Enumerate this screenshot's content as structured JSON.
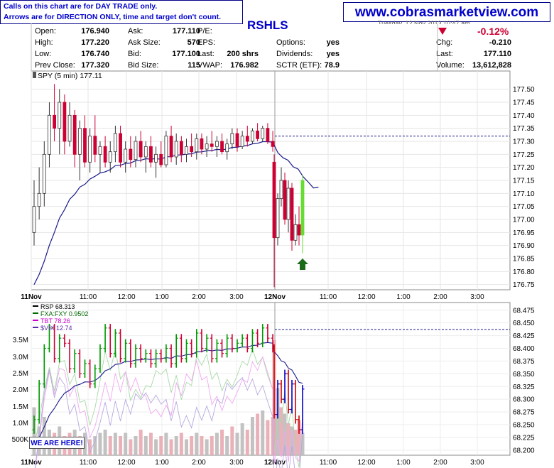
{
  "notice": {
    "line1": "Calls on this chart are for DAY TRADE only.",
    "line2": "Arrows are for DIRECTION ONLY, time and target don't count."
  },
  "brand": "www.cobrasmarketview.com",
  "ticker": "RSHLS",
  "date_header": "Tuesday, 12 Nov 2013 10:47 am",
  "change_percent": "-0.12%",
  "quote": {
    "open_label": "Open:",
    "open": "176.940",
    "high_label": "High:",
    "high": "177.220",
    "low_label": "Low:",
    "low": "176.740",
    "prevclose_label": "Prev Close:",
    "prevclose": "177.320",
    "ask_label": "Ask:",
    "ask": "177.110",
    "asksize_label": "Ask Size:",
    "asksize": "570",
    "bid_label": "Bid:",
    "bid": "177.100",
    "bidsize_label": "Bid Size:",
    "bidsize": "115",
    "pe_label": "P/E:",
    "pe": "",
    "eps_label": "EPS:",
    "eps": "",
    "last_label": "Last:",
    "last_shares": "200 shrs",
    "vwap_label": "VWAP:",
    "vwap": "176.982",
    "options_label": "Options:",
    "options": "yes",
    "dividends_label": "Dividends:",
    "dividends": "yes",
    "sctr_label": "SCTR (ETF):",
    "sctr": "78.9",
    "chg_label": "Chg:",
    "chg": "-0.210",
    "last2_label": "Last:",
    "last2": "177.110",
    "volume_label": "Volume:",
    "volume": "13,612,828"
  },
  "colors": {
    "up": "#009900",
    "down": "#cc0033",
    "ma": "#1a1a8c",
    "brand": "#0000cc",
    "signal": "#1a6a1a",
    "spy_up_candle": "#ffffff",
    "spy_down_candle": "#cc0033",
    "spy_last_candle": "#66dd33"
  },
  "here_label": "WE ARE HERE!",
  "chart_data": [
    {
      "type": "candlestick",
      "title": "SPY (5 min) 177.11",
      "symbol": "SPY",
      "interval": "5 min",
      "last": 177.11,
      "ylim": [
        176.73,
        177.57
      ],
      "yticks": [
        "177.50",
        "177.45",
        "177.40",
        "177.35",
        "177.30",
        "177.25",
        "177.20",
        "177.15",
        "177.10",
        "177.05",
        "177.00",
        "176.95",
        "176.90",
        "176.85",
        "176.80",
        "176.75"
      ],
      "xticks": [
        "11Nov",
        "11:00",
        "12:00",
        "1:00",
        "2:00",
        "3:00",
        "12Nov",
        "11:00",
        "12:00",
        "1:00",
        "2:00",
        "3:00"
      ],
      "reference_line": 177.32,
      "signal": "up arrow",
      "ohlc": [
        [
          176.95,
          177.15,
          176.9,
          177.05
        ],
        [
          177.05,
          177.2,
          177.0,
          177.1
        ],
        [
          177.1,
          177.3,
          177.05,
          177.25
        ],
        [
          177.25,
          177.45,
          177.2,
          177.4
        ],
        [
          177.4,
          177.52,
          177.3,
          177.35
        ],
        [
          177.35,
          177.5,
          177.25,
          177.45
        ],
        [
          177.45,
          177.48,
          177.25,
          177.3
        ],
        [
          177.3,
          177.45,
          177.28,
          177.4
        ],
        [
          177.4,
          177.42,
          177.2,
          177.25
        ],
        [
          177.25,
          177.38,
          177.15,
          177.35
        ],
        [
          177.35,
          177.4,
          177.2,
          177.22
        ],
        [
          177.22,
          177.35,
          177.18,
          177.32
        ],
        [
          177.32,
          177.4,
          177.22,
          177.25
        ],
        [
          177.25,
          177.3,
          177.18,
          177.28
        ],
        [
          177.28,
          177.32,
          177.2,
          177.22
        ],
        [
          177.22,
          177.3,
          177.18,
          177.26
        ],
        [
          177.26,
          177.36,
          177.22,
          177.33
        ],
        [
          177.33,
          177.36,
          177.2,
          177.22
        ],
        [
          177.22,
          177.3,
          177.18,
          177.27
        ],
        [
          177.27,
          177.32,
          177.2,
          177.23
        ],
        [
          177.23,
          177.32,
          177.2,
          177.3
        ],
        [
          177.3,
          177.34,
          177.22,
          177.24
        ],
        [
          177.24,
          177.3,
          177.18,
          177.28
        ],
        [
          177.28,
          177.32,
          177.2,
          177.22
        ],
        [
          177.22,
          177.28,
          177.16,
          177.25
        ],
        [
          177.25,
          177.3,
          177.2,
          177.21
        ],
        [
          177.21,
          177.34,
          177.2,
          177.32
        ],
        [
          177.32,
          177.36,
          177.22,
          177.24
        ],
        [
          177.24,
          177.33,
          177.21,
          177.3
        ],
        [
          177.3,
          177.32,
          177.22,
          177.25
        ],
        [
          177.25,
          177.31,
          177.22,
          177.28
        ],
        [
          177.28,
          177.33,
          177.24,
          177.26
        ],
        [
          177.26,
          177.33,
          177.23,
          177.31
        ],
        [
          177.31,
          177.33,
          177.25,
          177.27
        ],
        [
          177.27,
          177.32,
          177.24,
          177.29
        ],
        [
          177.29,
          177.34,
          177.26,
          177.28
        ],
        [
          177.28,
          177.32,
          177.24,
          177.3
        ],
        [
          177.3,
          177.33,
          177.25,
          177.26
        ],
        [
          177.26,
          177.31,
          177.23,
          177.29
        ],
        [
          177.29,
          177.35,
          177.27,
          177.33
        ],
        [
          177.33,
          177.35,
          177.26,
          177.28
        ],
        [
          177.28,
          177.34,
          177.27,
          177.32
        ],
        [
          177.32,
          177.36,
          177.28,
          177.3
        ],
        [
          177.3,
          177.35,
          177.29,
          177.34
        ],
        [
          177.34,
          177.37,
          177.3,
          177.31
        ],
        [
          177.31,
          177.36,
          177.3,
          177.35
        ],
        [
          177.35,
          177.37,
          177.29,
          177.3
        ],
        [
          177.3,
          177.34,
          177.26,
          177.28
        ],
        [
          177.22,
          177.25,
          176.74,
          176.93
        ],
        [
          176.93,
          177.1,
          176.9,
          177.08
        ],
        [
          177.08,
          177.2,
          177.05,
          177.15
        ],
        [
          177.15,
          177.18,
          176.98,
          177.0
        ],
        [
          177.0,
          177.15,
          176.95,
          177.12
        ],
        [
          177.12,
          177.14,
          176.88,
          176.92
        ],
        [
          176.92,
          177.02,
          176.9,
          176.98
        ],
        [
          176.98,
          177.05,
          176.9,
          176.94
        ],
        [
          176.94,
          177.17,
          176.87,
          177.15
        ]
      ]
    },
    {
      "type": "line",
      "title": "RSP 68.313",
      "series": [
        {
          "name": "RSP",
          "last": 68.313
        },
        {
          "name": "FXA:FXY",
          "last": 0.9502
        },
        {
          "name": "TBT",
          "last": 78.26
        },
        {
          "name": "$VIX",
          "last": 12.74
        }
      ],
      "ylim": [
        68.19,
        68.49
      ],
      "yticks": [
        "68.475",
        "68.450",
        "68.425",
        "68.400",
        "68.375",
        "68.350",
        "68.325",
        "68.300",
        "68.275",
        "68.250",
        "68.225",
        "68.200"
      ],
      "volume_ticks": [
        "3.5M",
        "3.0M",
        "2.5M",
        "2.0M",
        "1.5M",
        "1.0M",
        "500K"
      ],
      "xticks": [
        "11Nov",
        "11:00",
        "12:00",
        "1:00",
        "2:00",
        "3:00",
        "12Nov",
        "11:00",
        "12:00",
        "1:00",
        "2:00",
        "3:00"
      ],
      "reference_line": 68.437,
      "rsp_close": [
        68.26,
        68.33,
        68.4,
        68.44,
        68.38,
        68.42,
        68.41,
        68.36,
        68.39,
        68.35,
        68.37,
        68.33,
        68.36,
        68.4,
        68.44,
        68.39,
        68.43,
        68.38,
        68.41,
        68.37,
        68.4,
        68.38,
        68.39,
        68.37,
        68.39,
        68.38,
        68.4,
        68.37,
        68.42,
        68.38,
        68.41,
        68.39,
        68.43,
        68.4,
        68.42,
        68.38,
        68.41,
        68.39,
        68.42,
        68.4,
        68.41,
        68.42,
        68.4,
        68.43,
        68.41,
        68.44,
        68.42,
        68.4,
        68.27,
        68.33,
        68.3,
        68.35,
        68.28,
        68.33,
        68.26,
        68.24,
        68.32
      ],
      "volume_millions": [
        1.5,
        0.9,
        1.2,
        0.8,
        0.7,
        0.9,
        0.6,
        0.7,
        0.8,
        0.6,
        0.7,
        0.5,
        0.6,
        0.7,
        0.8,
        0.6,
        0.7,
        0.6,
        0.7,
        0.5,
        0.6,
        0.8,
        0.6,
        0.7,
        0.5,
        0.6,
        0.7,
        0.5,
        0.6,
        0.7,
        0.5,
        0.6,
        0.7,
        0.6,
        0.5,
        0.6,
        0.7,
        0.8,
        0.6,
        0.9,
        0.7,
        1.0,
        0.8,
        1.2,
        1.3,
        1.4,
        1.1,
        1.2,
        3.6,
        2.1,
        1.5,
        1.3,
        1.0,
        0.9,
        0.8,
        1.1,
        0.7
      ]
    }
  ]
}
